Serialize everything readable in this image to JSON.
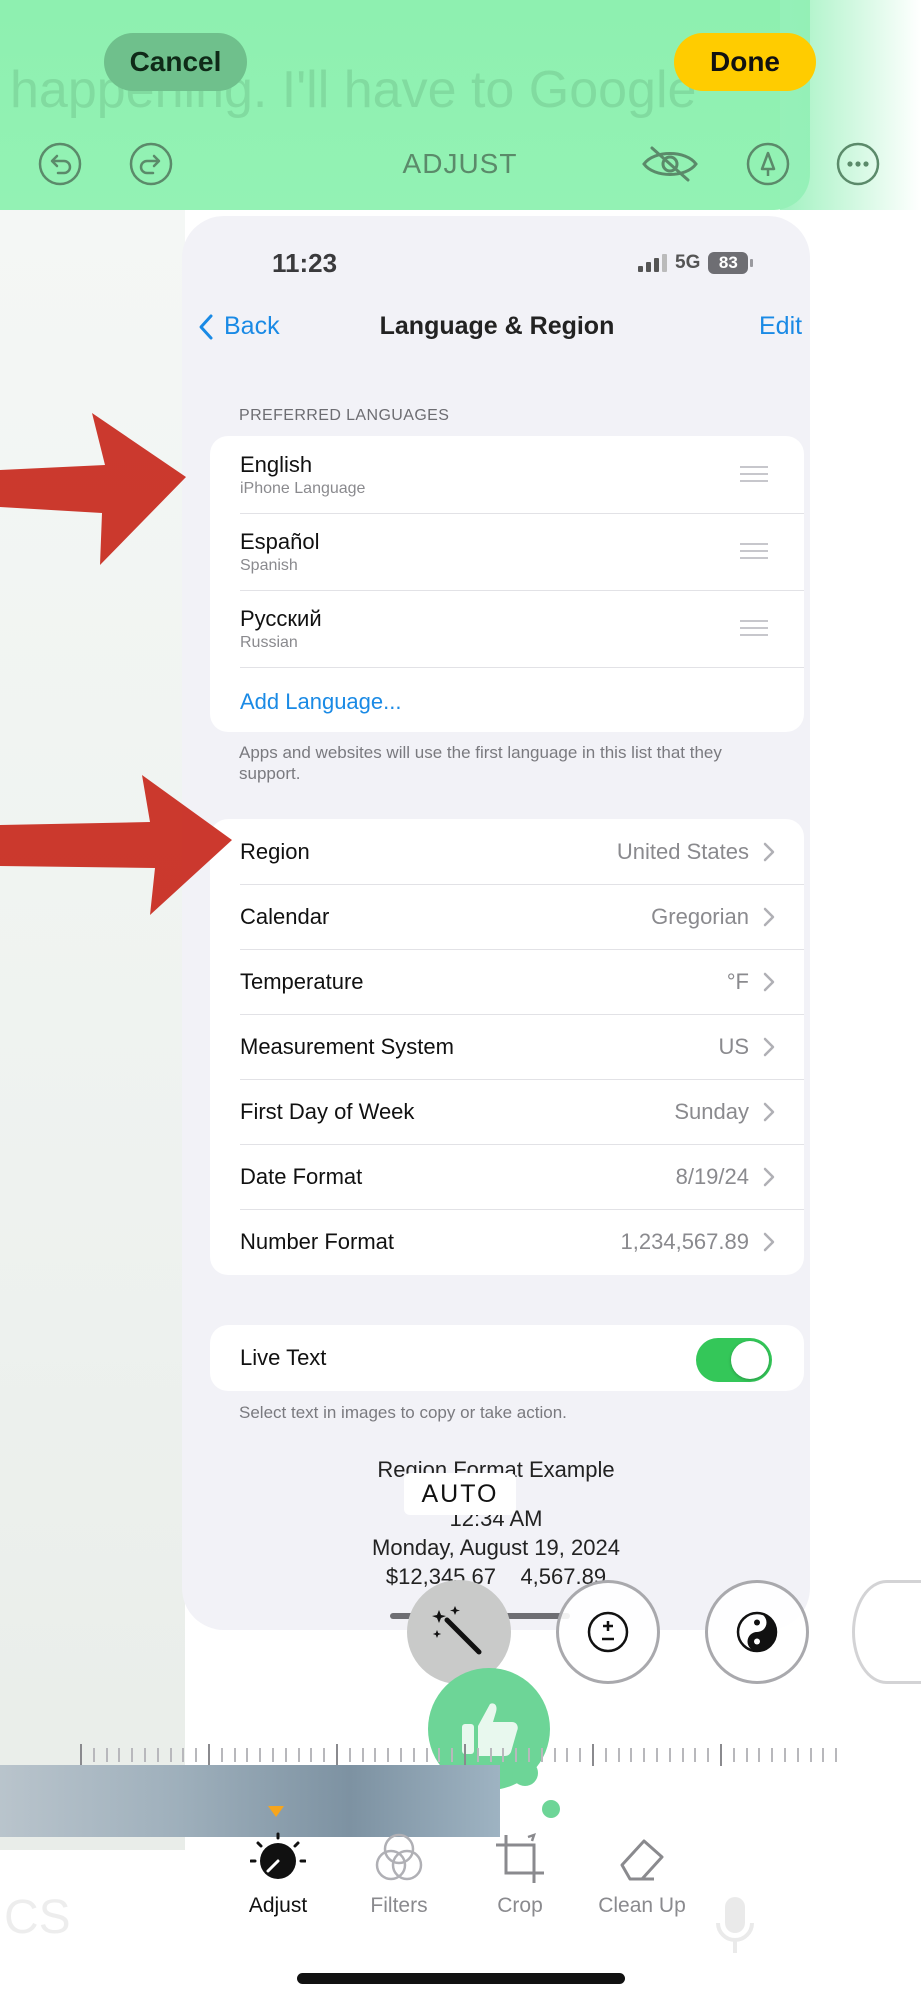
{
  "editor": {
    "ghost_text": "happening. I'll have to Google",
    "cancel_label": "Cancel",
    "done_label": "Done",
    "title": "ADJUST",
    "auto_label": "AUTO"
  },
  "status_bar": {
    "time": "11:23",
    "network": "5G",
    "battery": "83"
  },
  "nav": {
    "back_label": "Back",
    "title": "Language & Region",
    "edit_label": "Edit"
  },
  "preferred_languages": {
    "header": "PREFERRED LANGUAGES",
    "items": [
      {
        "name": "English",
        "sub": "iPhone Language"
      },
      {
        "name": "Español",
        "sub": "Spanish"
      },
      {
        "name": "Русский",
        "sub": "Russian"
      }
    ],
    "add_label": "Add Language...",
    "footnote": "Apps and websites will use the first language in this list that they support."
  },
  "settings": [
    {
      "label": "Region",
      "value": "United States"
    },
    {
      "label": "Calendar",
      "value": "Gregorian"
    },
    {
      "label": "Temperature",
      "value": "°F"
    },
    {
      "label": "Measurement System",
      "value": "US"
    },
    {
      "label": "First Day of Week",
      "value": "Sunday"
    },
    {
      "label": "Date Format",
      "value": "8/19/24"
    },
    {
      "label": "Number Format",
      "value": "1,234,567.89"
    }
  ],
  "live_text": {
    "label": "Live Text",
    "enabled": true,
    "footnote": "Select text in images to copy or take action."
  },
  "region_example": {
    "title": "Region Format Example",
    "time": "12:34 AM",
    "date": "Monday, August 19, 2024",
    "numbers": "$12,345.67    4,567.89"
  },
  "bottom_tabs": [
    {
      "label": "Adjust",
      "active": true
    },
    {
      "label": "Filters",
      "active": false
    },
    {
      "label": "Crop",
      "active": false
    },
    {
      "label": "Clean Up",
      "active": false
    }
  ],
  "ghost_bottom_text": "CS",
  "colors": {
    "editor_green": "#8ef0b0",
    "done_yellow": "#ffcc00",
    "ios_blue": "#1a8ae5",
    "toggle_green": "#34c759",
    "annotation_red": "#c8281c",
    "active_indicator": "#f7a51c"
  },
  "icons": [
    "undo-icon",
    "redo-icon",
    "hide-eye-icon",
    "markup-pen-icon",
    "more-icon",
    "back-chevron-icon",
    "drag-handle-icon",
    "chevron-right-icon",
    "auto-wand-icon",
    "exposure-icon",
    "brilliance-icon",
    "thumbs-up-icon",
    "adjust-dial-icon",
    "filters-icon",
    "crop-icon",
    "eraser-icon"
  ]
}
